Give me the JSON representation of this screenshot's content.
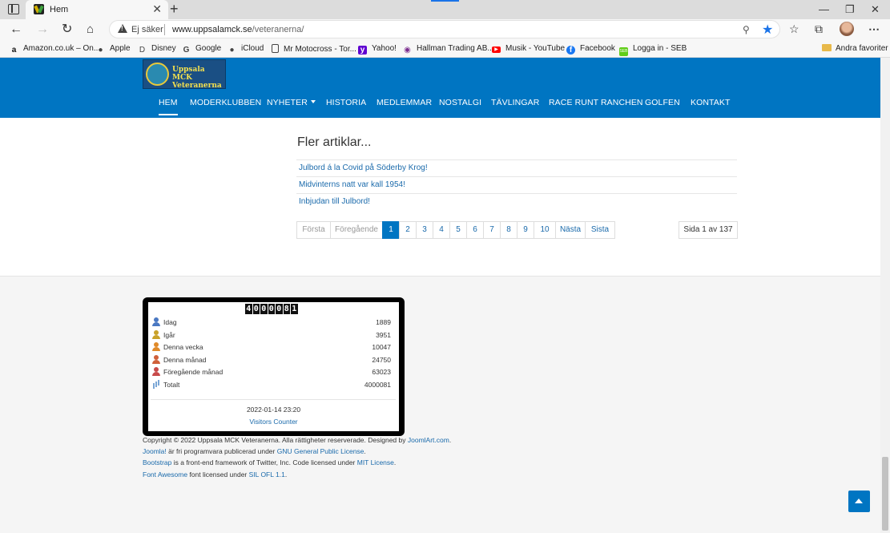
{
  "browser": {
    "tab_title": "Hem",
    "tab_close": "✕",
    "new_tab": "+",
    "not_secure": "Ej säker",
    "url_host": "www.uppsalamck.se",
    "url_path": "/veteranerna/",
    "bookmarks": [
      {
        "label": "Amazon.co.uk – On...",
        "icon": "amazon-icon",
        "color": "#111111"
      },
      {
        "label": "Apple",
        "icon": "apple-icon",
        "color": "#444444"
      },
      {
        "label": "Disney",
        "icon": "disney-icon",
        "color": "#444444"
      },
      {
        "label": "Google",
        "icon": "google-icon",
        "color": "#444444"
      },
      {
        "label": "iCloud",
        "icon": "apple-icon",
        "color": "#444444"
      },
      {
        "label": "Mr Motocross - Tor...",
        "icon": "page-icon",
        "color": "#444444"
      },
      {
        "label": "Yahoo!",
        "icon": "yahoo-icon",
        "color": "#5f01d1"
      },
      {
        "label": "Hallman Trading AB...",
        "icon": "location-pin-icon",
        "color": "#7b2d8e"
      },
      {
        "label": "Musik - YouTube",
        "icon": "youtube-icon",
        "color": "#ff0000"
      },
      {
        "label": "Facebook",
        "icon": "facebook-icon",
        "color": "#1877f2"
      },
      {
        "label": "Logga in - SEB",
        "icon": "seb-icon",
        "color": "#60cd18"
      }
    ],
    "other_favorites": "Andra favoriter"
  },
  "site": {
    "logo_line1": "Uppsala MCK",
    "logo_line2": "Veteranerna",
    "nav": [
      {
        "label": "HEM",
        "active": true
      },
      {
        "label": "MODERKLUBBEN"
      },
      {
        "label": "NYHETER",
        "dropdown": true
      },
      {
        "label": "HISTORIA"
      },
      {
        "label": "MEDLEMMAR"
      },
      {
        "label": "NOSTALGI"
      },
      {
        "label": "TÄVLINGAR"
      },
      {
        "label": "RACE RUNT RANCHEN"
      },
      {
        "label": "GOLFEN"
      },
      {
        "label": "KONTAKT"
      }
    ],
    "brand_color": "#0075c2"
  },
  "main": {
    "more_title": "Fler artiklar...",
    "articles": [
      "Julbord á la Covid på Söderby Krog!",
      "Midvinterns natt var kall 1954!",
      "Inbjudan till Julbord!"
    ],
    "pagination": {
      "first": "Första",
      "prev": "Föregående",
      "pages": [
        "1",
        "2",
        "3",
        "4",
        "5",
        "6",
        "7",
        "8",
        "9",
        "10"
      ],
      "current": "1",
      "next": "Nästa",
      "last": "Sista",
      "page_count": "Sida 1 av 137"
    }
  },
  "counter": {
    "digits": [
      "4",
      "0",
      "0",
      "0",
      "0",
      "8",
      "1"
    ],
    "rows": [
      {
        "label": "Idag",
        "value": "1889",
        "icon": "person-blue-icon",
        "color": "#4a78c2"
      },
      {
        "label": "Igår",
        "value": "3951",
        "icon": "person-yellow-icon",
        "color": "#c9a22a"
      },
      {
        "label": "Denna vecka",
        "value": "10047",
        "icon": "person-orange-icon",
        "color": "#e08a2a"
      },
      {
        "label": "Denna månad",
        "value": "24750",
        "icon": "person-red-icon",
        "color": "#d0603a"
      },
      {
        "label": "Föregående månad",
        "value": "63023",
        "icon": "person-pink-icon",
        "color": "#c84a4a"
      },
      {
        "label": "Totalt",
        "value": "4000081",
        "icon": "bar-chart-icon",
        "color": "#7aa6d6"
      }
    ],
    "date": "2022-01-14 23:20",
    "link": "Visitors Counter"
  },
  "footer": {
    "copyright_text": "Copyright © 2022 Uppsala MCK Veteranerna. Alla rättigheter reserverade. Designed by ",
    "copyright_link": "JoomlArt.com",
    "copyright_end": ".",
    "joomla_link": "Joomla!",
    "joomla_text": " är fri programvara publicerad under ",
    "gnu_link": "GNU General Public License",
    "gnu_end": ".",
    "bootstrap_link": "Bootstrap",
    "bootstrap_text": " is a front-end framework of Twitter, Inc. Code licensed under ",
    "mit_link": "MIT License",
    "mit_end": ".",
    "fa_link": "Font Awesome",
    "fa_text": " font licensed under ",
    "sil_link": "SIL OFL 1.1",
    "sil_end": "."
  }
}
